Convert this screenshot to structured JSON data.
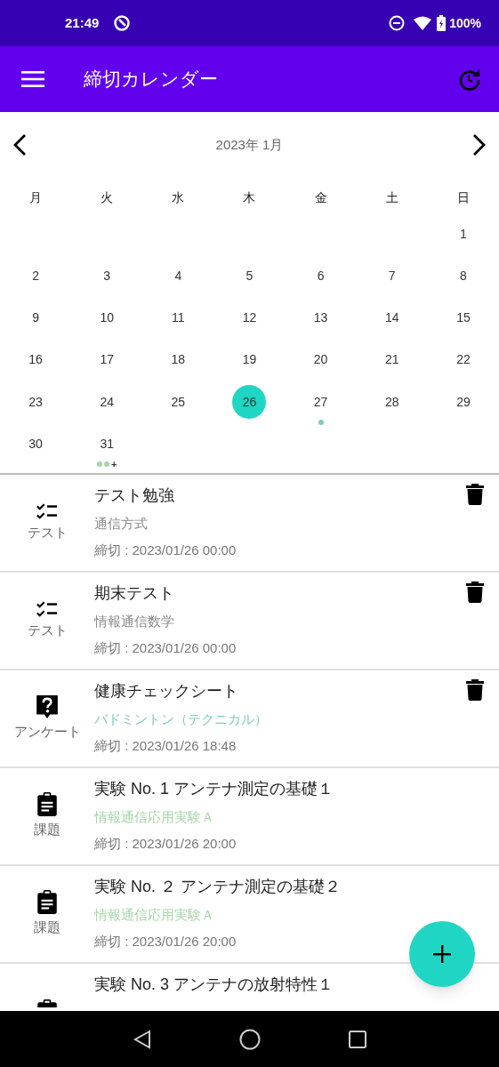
{
  "status_bar": {
    "time": "21:49",
    "battery": "100%"
  },
  "app_bar": {
    "title": "締切カレンダー"
  },
  "calendar": {
    "month": "2023年 1月",
    "weekdays": [
      "月",
      "火",
      "水",
      "木",
      "金",
      "土",
      "日"
    ],
    "weeks": [
      [
        {
          "day": "1",
          "selected": false
        }
      ],
      [
        {
          "day": "2",
          "selected": false
        },
        {
          "day": "3",
          "selected": false
        },
        {
          "day": "4",
          "selected": false
        },
        {
          "day": "5",
          "selected": false
        },
        {
          "day": "6",
          "selected": false
        },
        {
          "day": "7",
          "selected": false
        },
        {
          "day": "8",
          "selected": false
        }
      ],
      [
        {
          "day": "9",
          "selected": false
        },
        {
          "day": "10",
          "selected": false
        },
        {
          "day": "11",
          "selected": false
        },
        {
          "day": "12",
          "selected": false
        },
        {
          "day": "13",
          "selected": false
        },
        {
          "day": "14",
          "selected": false
        },
        {
          "day": "15",
          "selected": false
        }
      ],
      [
        {
          "day": "16",
          "selected": false
        },
        {
          "day": "17",
          "selected": false
        },
        {
          "day": "18",
          "selected": false
        },
        {
          "day": "19",
          "selected": false
        },
        {
          "day": "20",
          "selected": false
        },
        {
          "day": "21",
          "selected": false
        },
        {
          "day": "22",
          "selected": false
        }
      ],
      [
        {
          "day": "23",
          "selected": false
        },
        {
          "day": "24",
          "selected": false
        },
        {
          "day": "25",
          "selected": false
        },
        {
          "day": "26",
          "selected": true
        },
        {
          "day": "27",
          "selected": false,
          "dots": [
            {
              "color": "#80cbc4"
            }
          ]
        },
        {
          "day": "28",
          "selected": false
        },
        {
          "day": "29",
          "selected": false
        }
      ],
      [
        {
          "day": "30",
          "selected": false
        },
        {
          "day": "31",
          "selected": false,
          "dots": [
            {
              "color": "#a5d6a7"
            },
            {
              "color": "#a5d6a7"
            }
          ],
          "more": "+"
        }
      ]
    ]
  },
  "tasks": [
    {
      "kind": "test",
      "label": "テスト",
      "title": "テスト勉強",
      "course": "通信方式",
      "color": "#8a8a8a",
      "deadline": "締切 : 2023/01/26 00:00",
      "deletable": true
    },
    {
      "kind": "test",
      "label": "テスト",
      "title": "期末テスト",
      "course": "情報通信数学",
      "color": "#8a8a8a",
      "deadline": "締切 : 2023/01/26 00:00",
      "deletable": true
    },
    {
      "kind": "survey",
      "label": "アンケート",
      "title": "健康チェックシート",
      "course": "バドミントン（テクニカル）",
      "color": "#80cbc4",
      "deadline": "締切 : 2023/01/26 18:48",
      "deletable": true
    },
    {
      "kind": "assignment",
      "label": "課題",
      "title": "実験 No. 1 アンテナ測定の基礎１",
      "course": "情報通信応用実験Ａ",
      "color": "#a5d6a7",
      "deadline": "締切 : 2023/01/26 20:00",
      "deletable": false
    },
    {
      "kind": "assignment",
      "label": "課題",
      "title": "実験 No.  ２ アンテナ測定の基礎２",
      "course": "情報通信応用実験Ａ",
      "color": "#a5d6a7",
      "deadline": "締切 : 2023/01/26 20:00",
      "deletable": false
    },
    {
      "kind": "assignment",
      "title": "実験 No. 3 アンテナの放射特性１",
      "deletable": false
    }
  ]
}
